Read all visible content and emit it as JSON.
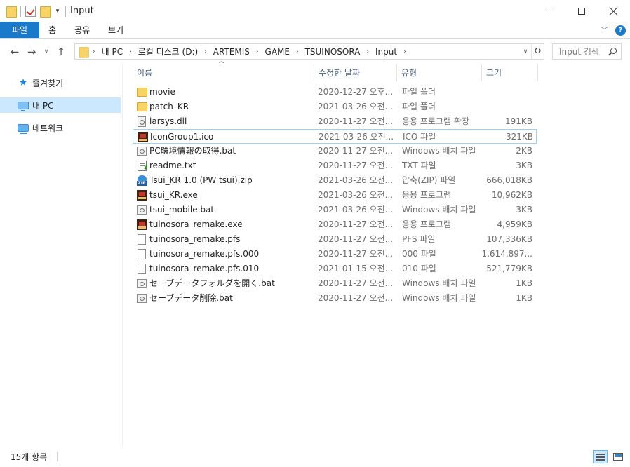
{
  "window": {
    "title": "Input"
  },
  "ribbon": {
    "tabs": [
      {
        "label": "파일"
      },
      {
        "label": "홈"
      },
      {
        "label": "공유"
      },
      {
        "label": "보기"
      }
    ],
    "help_label": "?"
  },
  "address": {
    "breadcrumbs": [
      "내 PC",
      "로컬 디스크 (D:)",
      "ARTEMIS",
      "GAME",
      "TSUINOSORA",
      "Input"
    ]
  },
  "search": {
    "placeholder": "Input 검색"
  },
  "navpane": {
    "items": [
      {
        "label": "즐겨찾기"
      },
      {
        "label": "내 PC"
      },
      {
        "label": "네트워크"
      }
    ]
  },
  "columns": {
    "name": "이름",
    "date": "수정한 날짜",
    "type": "유형",
    "size": "크기"
  },
  "files": [
    {
      "icon": "folder-icon",
      "name": "movie",
      "date": "2020-12-27 오후...",
      "type": "파일 폴더",
      "size": ""
    },
    {
      "icon": "folder-icon",
      "name": "patch_KR",
      "date": "2021-03-26 오전...",
      "type": "파일 폴더",
      "size": ""
    },
    {
      "icon": "dll-file-icon",
      "name": "iarsys.dll",
      "date": "2020-11-27 오전...",
      "type": "응용 프로그램 확장",
      "size": "191KB"
    },
    {
      "icon": "ico-file-icon",
      "name": "IconGroup1.ico",
      "date": "2021-03-26 오전...",
      "type": "ICO 파일",
      "size": "321KB"
    },
    {
      "icon": "batch-file-icon",
      "name": "PC環境情報の取得.bat",
      "date": "2020-11-27 오전...",
      "type": "Windows 배치 파일",
      "size": "2KB"
    },
    {
      "icon": "text-file-icon",
      "name": "readme.txt",
      "date": "2020-11-27 오전...",
      "type": "TXT 파일",
      "size": "3KB"
    },
    {
      "icon": "zip-file-icon",
      "name": "Tsui_KR 1.0 (PW tsui).zip",
      "date": "2021-03-26 오전...",
      "type": "압축(ZIP) 파일",
      "size": "666,018KB"
    },
    {
      "icon": "app-icon",
      "name": "tsui_KR.exe",
      "date": "2021-03-26 오전...",
      "type": "응용 프로그램",
      "size": "10,962KB"
    },
    {
      "icon": "batch-file-icon",
      "name": "tsui_mobile.bat",
      "date": "2021-03-26 오전...",
      "type": "Windows 배치 파일",
      "size": "3KB"
    },
    {
      "icon": "app-icon",
      "name": "tuinosora_remake.exe",
      "date": "2020-11-27 오전...",
      "type": "응용 프로그램",
      "size": "4,959KB"
    },
    {
      "icon": "generic-file-icon",
      "name": "tuinosora_remake.pfs",
      "date": "2020-11-27 오전...",
      "type": "PFS 파일",
      "size": "107,336KB"
    },
    {
      "icon": "generic-file-icon",
      "name": "tuinosora_remake.pfs.000",
      "date": "2020-11-27 오전...",
      "type": "000 파일",
      "size": "1,614,897..."
    },
    {
      "icon": "generic-file-icon",
      "name": "tuinosora_remake.pfs.010",
      "date": "2021-01-15 오전...",
      "type": "010 파일",
      "size": "521,779KB"
    },
    {
      "icon": "batch-file-icon",
      "name": "セーブデータフォルダを開く.bat",
      "date": "2020-11-27 오전...",
      "type": "Windows 배치 파일",
      "size": "1KB"
    },
    {
      "icon": "batch-file-icon",
      "name": "セーブデータ削除.bat",
      "date": "2020-11-27 오전...",
      "type": "Windows 배치 파일",
      "size": "1KB"
    }
  ],
  "selected_file": "IconGroup1.ico",
  "status": {
    "item_count": "15개 항목"
  },
  "colors": {
    "accent": "#1979ca",
    "selection": "#cce8ff",
    "selection_border": "#99d1ff"
  }
}
